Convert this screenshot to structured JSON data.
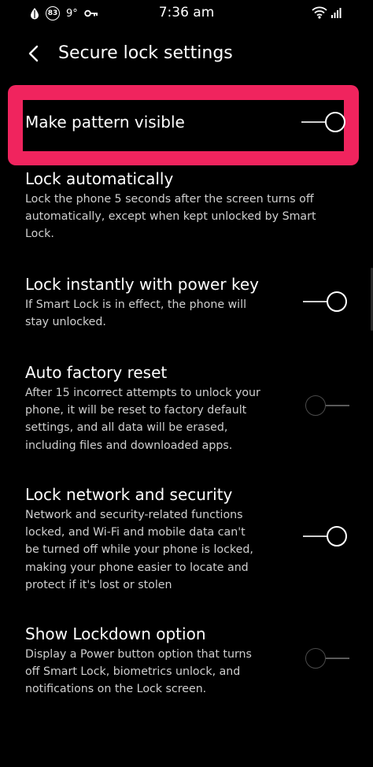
{
  "status_bar": {
    "notification_badge": "83",
    "temperature": "9°",
    "time": "7:36 am"
  },
  "header": {
    "title": "Secure lock settings"
  },
  "settings": [
    {
      "title": "Make pattern visible",
      "description": "",
      "toggle": "on"
    },
    {
      "title": "Lock automatically",
      "description_lines": [
        "Lock the phone 5 seconds after the screen turns off",
        "automatically, except when kept unlocked by Smart",
        "Lock."
      ]
    },
    {
      "title": "Lock instantly with power key",
      "description_lines": [
        "If Smart Lock is in effect, the phone will",
        "stay unlocked."
      ],
      "toggle": "on"
    },
    {
      "title": "Auto factory reset",
      "description_lines": [
        "After 15 incorrect attempts to unlock your",
        "phone, it will be reset to factory default",
        "settings, and all data will be erased,",
        "including files and downloaded apps."
      ],
      "toggle": "off"
    },
    {
      "title": "Lock network and security",
      "description_lines": [
        "Network and security-related functions",
        "locked, and Wi-Fi and mobile data can't",
        "be turned off while your phone is locked,",
        "making your phone easier to locate and",
        "protect if it's lost or stolen"
      ],
      "toggle": "on"
    },
    {
      "title": "Show Lockdown option",
      "description_lines": [
        "Display a Power button option that turns",
        "off Smart Lock, biometrics unlock, and",
        "notifications on the Lock screen."
      ],
      "toggle": "off"
    }
  ],
  "colors": {
    "background": "#000000",
    "highlight": "#f0245e",
    "text": "#ffffff",
    "secondary_text": "#cfcfcf"
  },
  "icons": {
    "back": "chevron-left-icon",
    "status_left": [
      "drop-icon",
      "badge-circle-icon",
      "key-icon"
    ],
    "status_right": [
      "wifi-icon",
      "signal-icon"
    ]
  }
}
